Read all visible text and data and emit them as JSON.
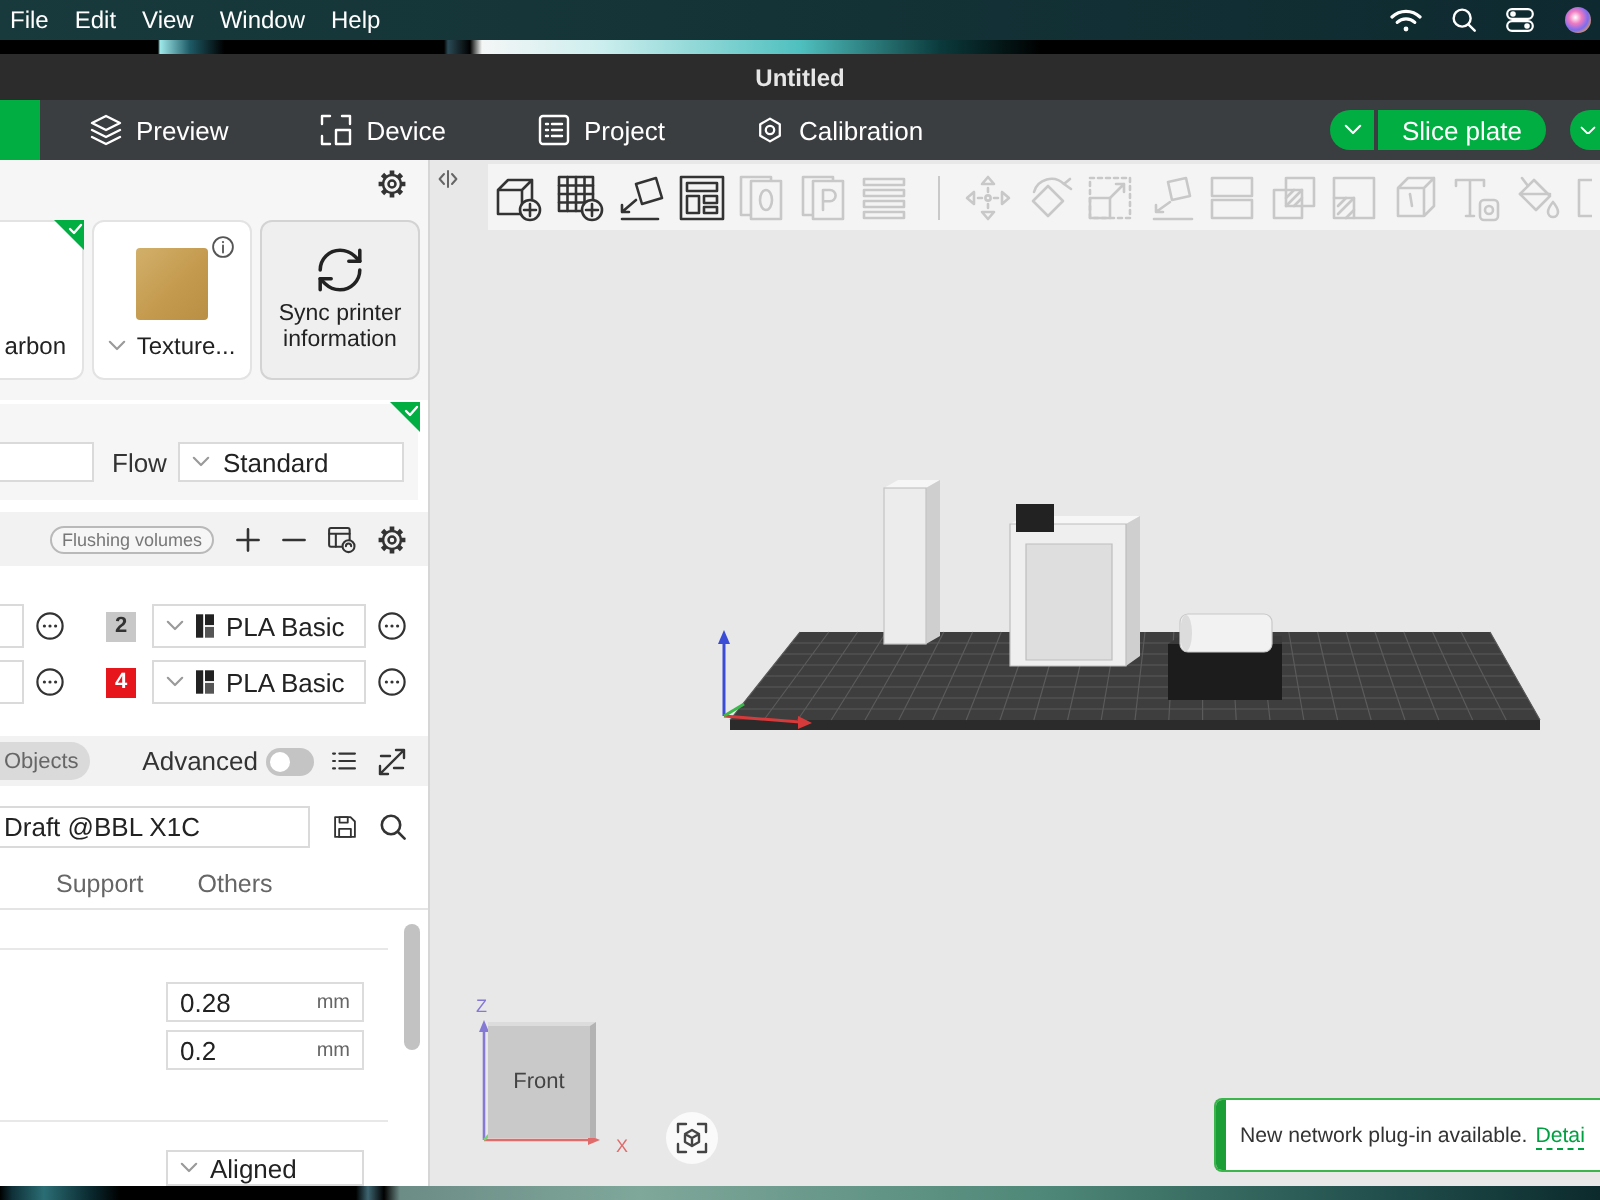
{
  "menu_bar": [
    "File",
    "Edit",
    "View",
    "Window",
    "Help"
  ],
  "window": {
    "title": "Untitled"
  },
  "tabs": [
    {
      "selected": true
    },
    {
      "label": "Preview",
      "selected": false
    },
    {
      "label": "Device",
      "selected": false
    },
    {
      "label": "Project",
      "selected": false
    },
    {
      "label": "Calibration",
      "selected": false
    }
  ],
  "slice": {
    "label": "Slice plate"
  },
  "printer": {
    "cards": [
      {
        "kind": "printer",
        "label": "arbon",
        "synced": true
      },
      {
        "kind": "plate",
        "label": "Texture...",
        "synced": false
      }
    ],
    "sync_button": "Sync printer information"
  },
  "nozzle": {
    "synced": true,
    "flow_label": "Flow",
    "flow_value": "Standard"
  },
  "filament": {
    "flushing_button": "Flushing volumes",
    "slots": [
      {
        "number": "2",
        "color": "#c8c8c8",
        "name": "PLA Basic"
      },
      {
        "number": "4",
        "color": "#e6161c",
        "name": "PLA Basic"
      }
    ]
  },
  "process": {
    "mode": "Objects",
    "advanced_label": "Advanced",
    "advanced": false,
    "preset": "Draft @BBL X1C",
    "tabs": [
      {
        "label": "Support",
        "selected": false
      },
      {
        "label": "Others",
        "selected": false
      }
    ],
    "fields": [
      {
        "value": "0.28",
        "unit": "mm"
      },
      {
        "value": "0.2",
        "unit": "mm"
      }
    ],
    "seam": "Aligned"
  },
  "viewport": {
    "toolbar": {
      "groups": [
        {
          "tools": [
            {
              "disabled": false
            },
            {
              "disabled": false
            },
            {
              "disabled": false
            },
            {
              "disabled": false
            },
            {
              "disabled": true
            },
            {
              "disabled": true
            },
            {
              "disabled": true
            }
          ]
        },
        {
          "tools": [
            {
              "disabled": true
            },
            {
              "disabled": true
            },
            {
              "disabled": true
            },
            {
              "disabled": true
            },
            {
              "disabled": true
            },
            {
              "disabled": true
            },
            {
              "disabled": true
            },
            {
              "disabled": true
            },
            {
              "disabled": true
            },
            {
              "disabled": true
            },
            {
              "disabled": true
            }
          ]
        }
      ]
    },
    "view_cube": {
      "face": "Front",
      "z_label": "Z",
      "x_label": "X"
    },
    "notification": {
      "message": "New network plug-in available.",
      "link": "Detai"
    }
  }
}
